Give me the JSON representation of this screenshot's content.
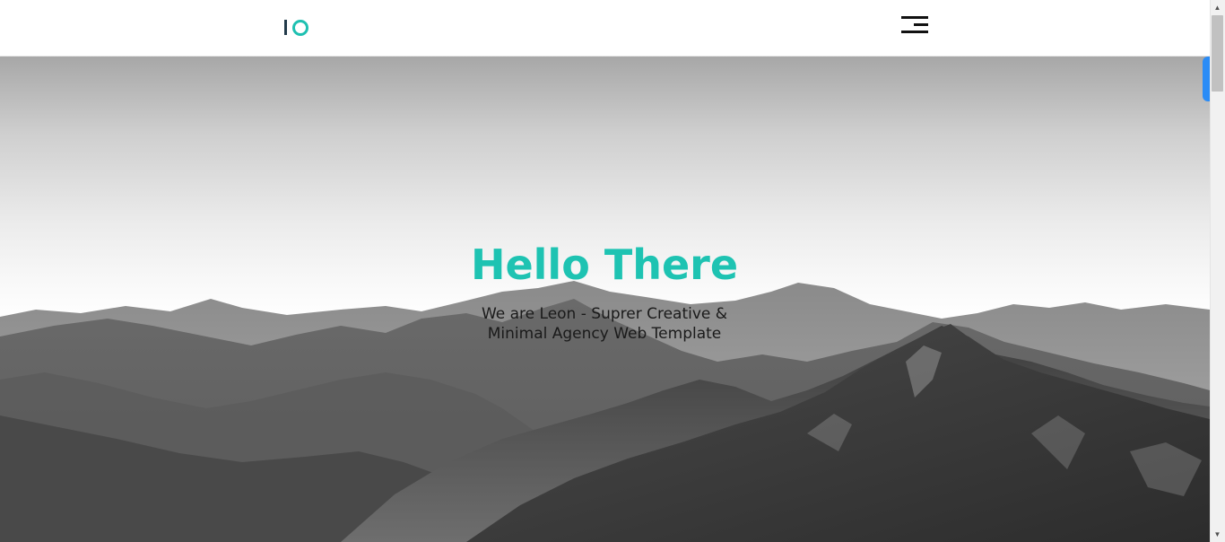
{
  "header": {
    "logo_icon": "io-logo-icon",
    "menu_icon": "hamburger-menu-icon"
  },
  "hero": {
    "title": "Hello There",
    "subtitle": "We are Leon - Suprer Creative & Minimal Agency Web Template",
    "background": "grayscale-mountain-range"
  },
  "colors": {
    "accent": "#1ec3b2",
    "logo_dark": "#223a4a",
    "side_tab": "#2b8cf6"
  }
}
